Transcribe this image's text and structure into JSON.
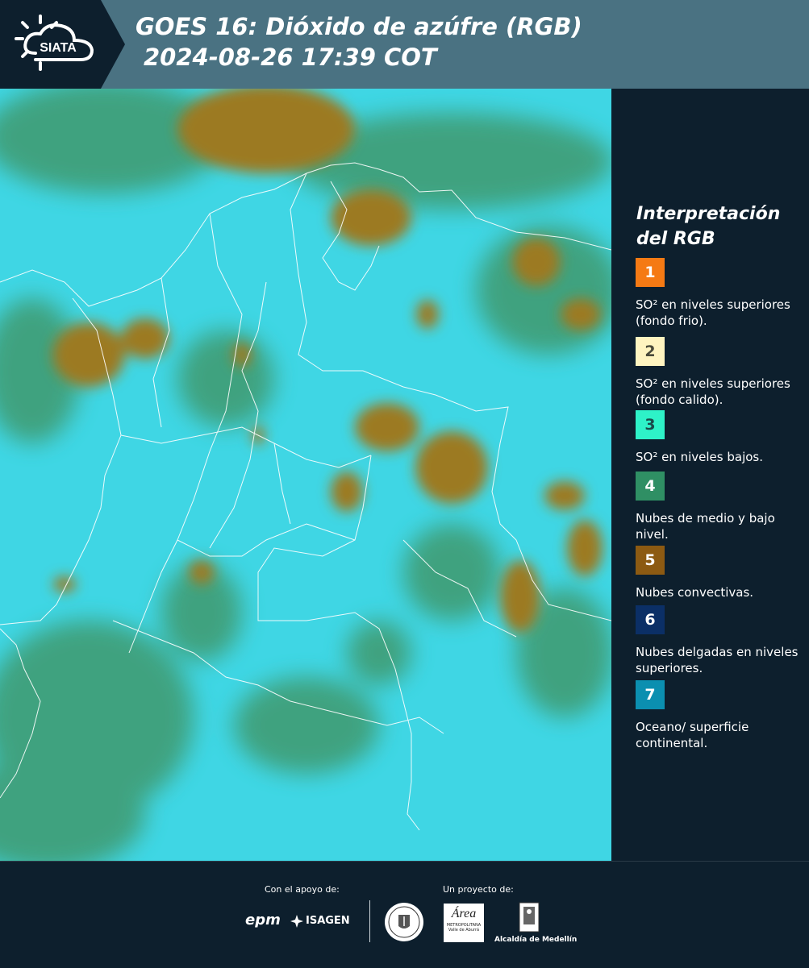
{
  "header": {
    "logo_text": "SIATA",
    "title_line1": "GOES 16: Dióxido de azúfre (RGB)",
    "title_line2": "2024-08-26 17:39 COT"
  },
  "legend": {
    "title": "Interpretación del RGB",
    "items": [
      {
        "num": "1",
        "color": "#f57a14",
        "label": "SO² en niveles superiores (fondo frio)."
      },
      {
        "num": "2",
        "color": "#fff4c0",
        "label": "SO² en niveles superiores (fondo calido)."
      },
      {
        "num": "3",
        "color": "#2ef2c8",
        "label": "SO² en niveles bajos."
      },
      {
        "num": "4",
        "color": "#2f8f64",
        "label": "Nubes de medio y bajo nivel."
      },
      {
        "num": "5",
        "color": "#8c5a12",
        "label": "Nubes convectivas."
      },
      {
        "num": "6",
        "color": "#0b2f66",
        "label": "Nubes delgadas en niveles superiores."
      },
      {
        "num": "7",
        "color": "#0b8fb0",
        "label": "Oceano/ superficie continental."
      }
    ]
  },
  "footer": {
    "support_label": "Con el apoyo de:",
    "project_label": "Un proyecto de:",
    "sponsor_epm": "epm",
    "sponsor_isagen": "ISAGEN",
    "area_logo": "Área",
    "area_line1": "METROPOLITANA",
    "area_line2": "Valle de Aburrá",
    "alcaldia": "Alcaldía de Medellín"
  }
}
